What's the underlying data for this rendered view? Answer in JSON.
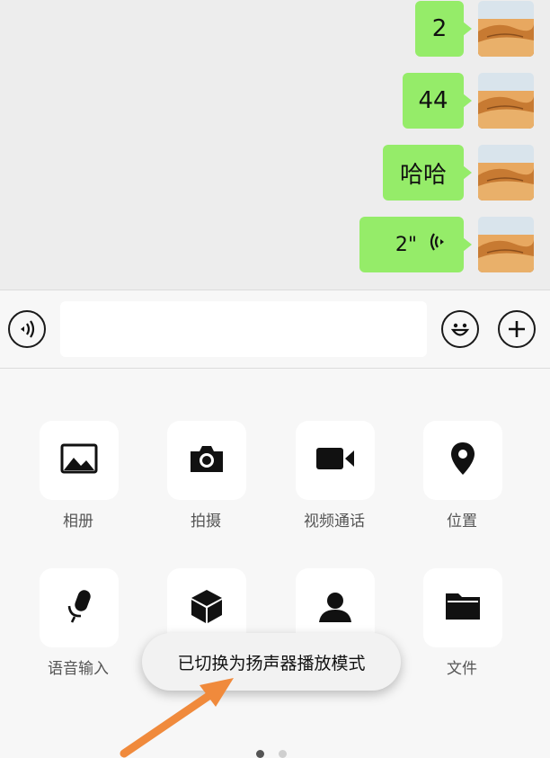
{
  "chat": {
    "messages": [
      {
        "text": "2"
      },
      {
        "text": "44"
      },
      {
        "text": "哈哈"
      },
      {
        "text": "2\"",
        "type": "voice"
      }
    ]
  },
  "panel": {
    "items": [
      {
        "label": "相册",
        "icon": "photo-icon"
      },
      {
        "label": "拍摄",
        "icon": "camera-icon"
      },
      {
        "label": "视频通话",
        "icon": "video-call-icon"
      },
      {
        "label": "位置",
        "icon": "location-icon"
      },
      {
        "label": "语音输入",
        "icon": "microphone-icon"
      },
      {
        "label": "",
        "icon": "cube-icon"
      },
      {
        "label": "",
        "icon": "contact-card-icon"
      },
      {
        "label": "文件",
        "icon": "folder-icon"
      }
    ]
  },
  "toast": {
    "text": "已切换为扬声器播放模式"
  },
  "pager": {
    "current": 1,
    "total": 2
  },
  "colors": {
    "bubble": "#95ec69",
    "chat_bg": "#ededed",
    "panel_bg": "#f7f7f7",
    "arrow": "#f08a3c"
  }
}
